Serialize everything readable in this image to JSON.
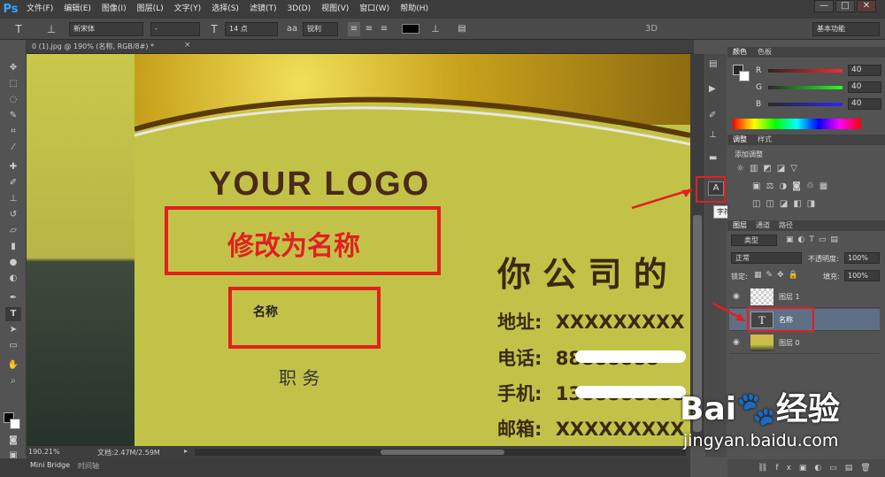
{
  "app_logo": "Ps",
  "menu": [
    "文件(F)",
    "编辑(E)",
    "图像(I)",
    "图层(L)",
    "文字(Y)",
    "选择(S)",
    "滤镜(T)",
    "3D(D)",
    "视图(V)",
    "窗口(W)",
    "帮助(H)"
  ],
  "window_controls": [
    "—",
    "□",
    "✕"
  ],
  "options": {
    "tool_glyph": "T",
    "font_family": "新宋体",
    "font_style": "-",
    "font_size": "14 点",
    "aa_label": "aa",
    "aa_mode": "锐利",
    "mode_3d": "3D",
    "workspace": "基本功能"
  },
  "document": {
    "tab_title": "0 (1).jpg @ 190% (名称, RGB/8#) *",
    "close": "×"
  },
  "card": {
    "logo": "YOUR LOGO",
    "annotation": "修改为名称",
    "name_label": "名称",
    "position": "职 务",
    "company": "你 公 司 的",
    "address_label": "地址:",
    "address_value": "XXXXXXXXX",
    "phone_label": "电话:",
    "phone_value": "88888888",
    "mobile_label": "手机:",
    "mobile_value": "1388888888",
    "email_label": "邮箱:",
    "email_value": "XXXXXXXXX"
  },
  "character_panel_tooltip": "字符",
  "panels": {
    "color_tabs": [
      "颜色",
      "色板"
    ],
    "rgb": [
      {
        "channel": "R",
        "value": "40"
      },
      {
        "channel": "G",
        "value": "40"
      },
      {
        "channel": "B",
        "value": "40"
      }
    ],
    "adjust_tabs": [
      "调整",
      "样式"
    ],
    "adjust_title": "添加调整",
    "layers_tabs": [
      "图层",
      "通道",
      "路径"
    ],
    "filter_kind": "类型",
    "blend_mode": "正常",
    "opacity_label": "不透明度:",
    "opacity_value": "100%",
    "lock_label": "锁定:",
    "fill_label": "填充:",
    "fill_value": "100%",
    "layers": [
      {
        "name": "图层 1",
        "type": "raster-transparent"
      },
      {
        "name": "名称",
        "type": "text",
        "selected": true
      },
      {
        "name": "图层 0",
        "type": "raster-image"
      }
    ]
  },
  "status": {
    "zoom": "190.21%",
    "doc_size": "文档:2.47M/2.59M"
  },
  "bottom_tabs": [
    "Mini Bridge",
    "时间轴"
  ],
  "watermark": {
    "brand": "Bai",
    "brand_suffix": "经验",
    "url": "jingyan.baidu.com"
  },
  "colors": {
    "accent_blue": "#31a8ff",
    "annotation_red": "#e02020",
    "card_bg": "#c3c248"
  }
}
